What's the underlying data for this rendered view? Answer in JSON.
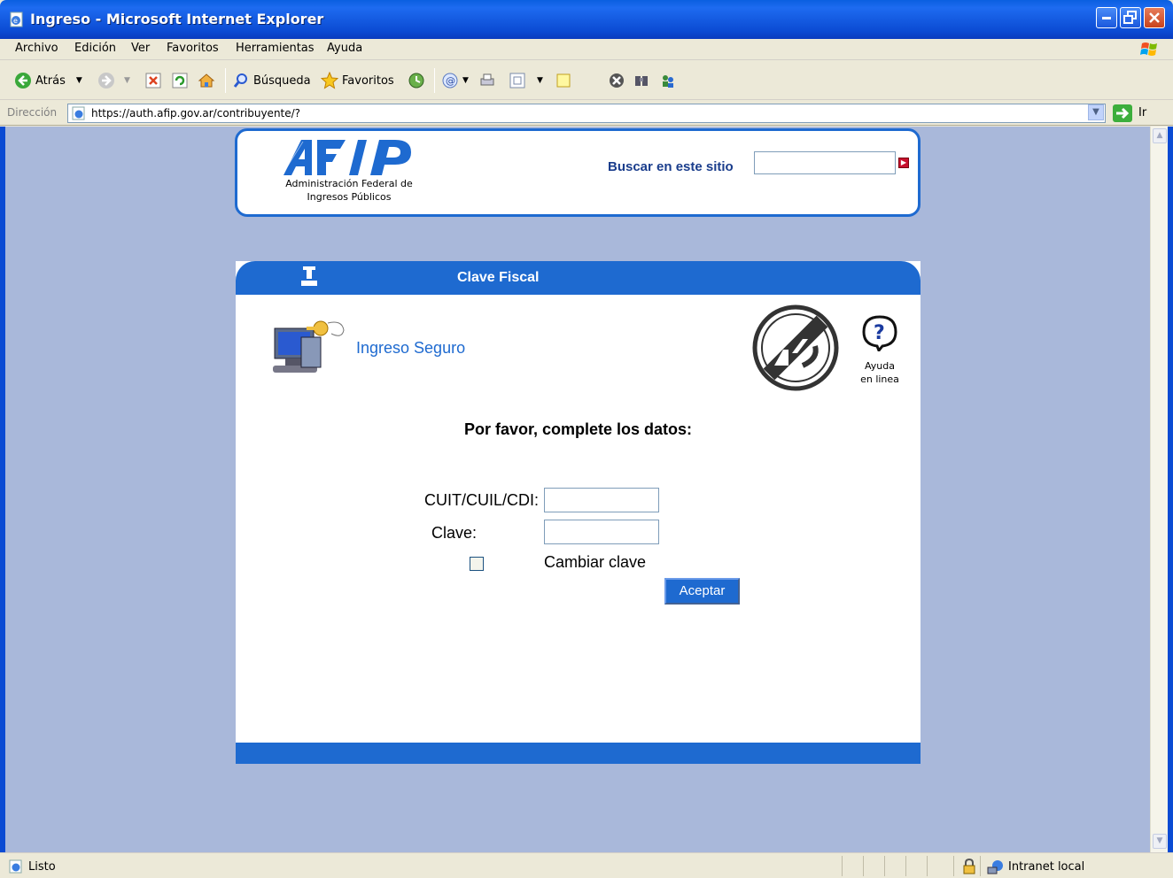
{
  "window": {
    "title": "Ingreso - Microsoft Internet Explorer"
  },
  "menu": {
    "items": [
      "Archivo",
      "Edición",
      "Ver",
      "Favoritos",
      "Herramientas",
      "Ayuda"
    ]
  },
  "toolbar": {
    "back_label": "Atrás",
    "search_label": "Búsqueda",
    "favorites_label": "Favoritos"
  },
  "address": {
    "label": "Dirección",
    "url": "https://auth.afip.gov.ar/contribuyente/?",
    "go_label": "Ir"
  },
  "header": {
    "org_line1": "Administración Federal de",
    "org_line2": "Ingresos Públicos",
    "search_label": "Buscar en este sitio",
    "search_value": ""
  },
  "panel": {
    "title": "Clave Fiscal",
    "secure_label": "Ingreso Seguro",
    "help_line1": "Ayuda",
    "help_line2": "en linea",
    "prompt": "Por favor, complete los datos:",
    "cuit_label": "CUIT/CUIL/CDI:",
    "cuit_value": "",
    "password_label": "Clave:",
    "password_value": "",
    "change_password_label": "Cambiar clave",
    "change_password_checked": false,
    "submit_label": "Aceptar"
  },
  "status": {
    "text": "Listo",
    "zone": "Intranet local"
  },
  "colors": {
    "accent": "#1E6AD0",
    "background": "#A9B8DA"
  }
}
